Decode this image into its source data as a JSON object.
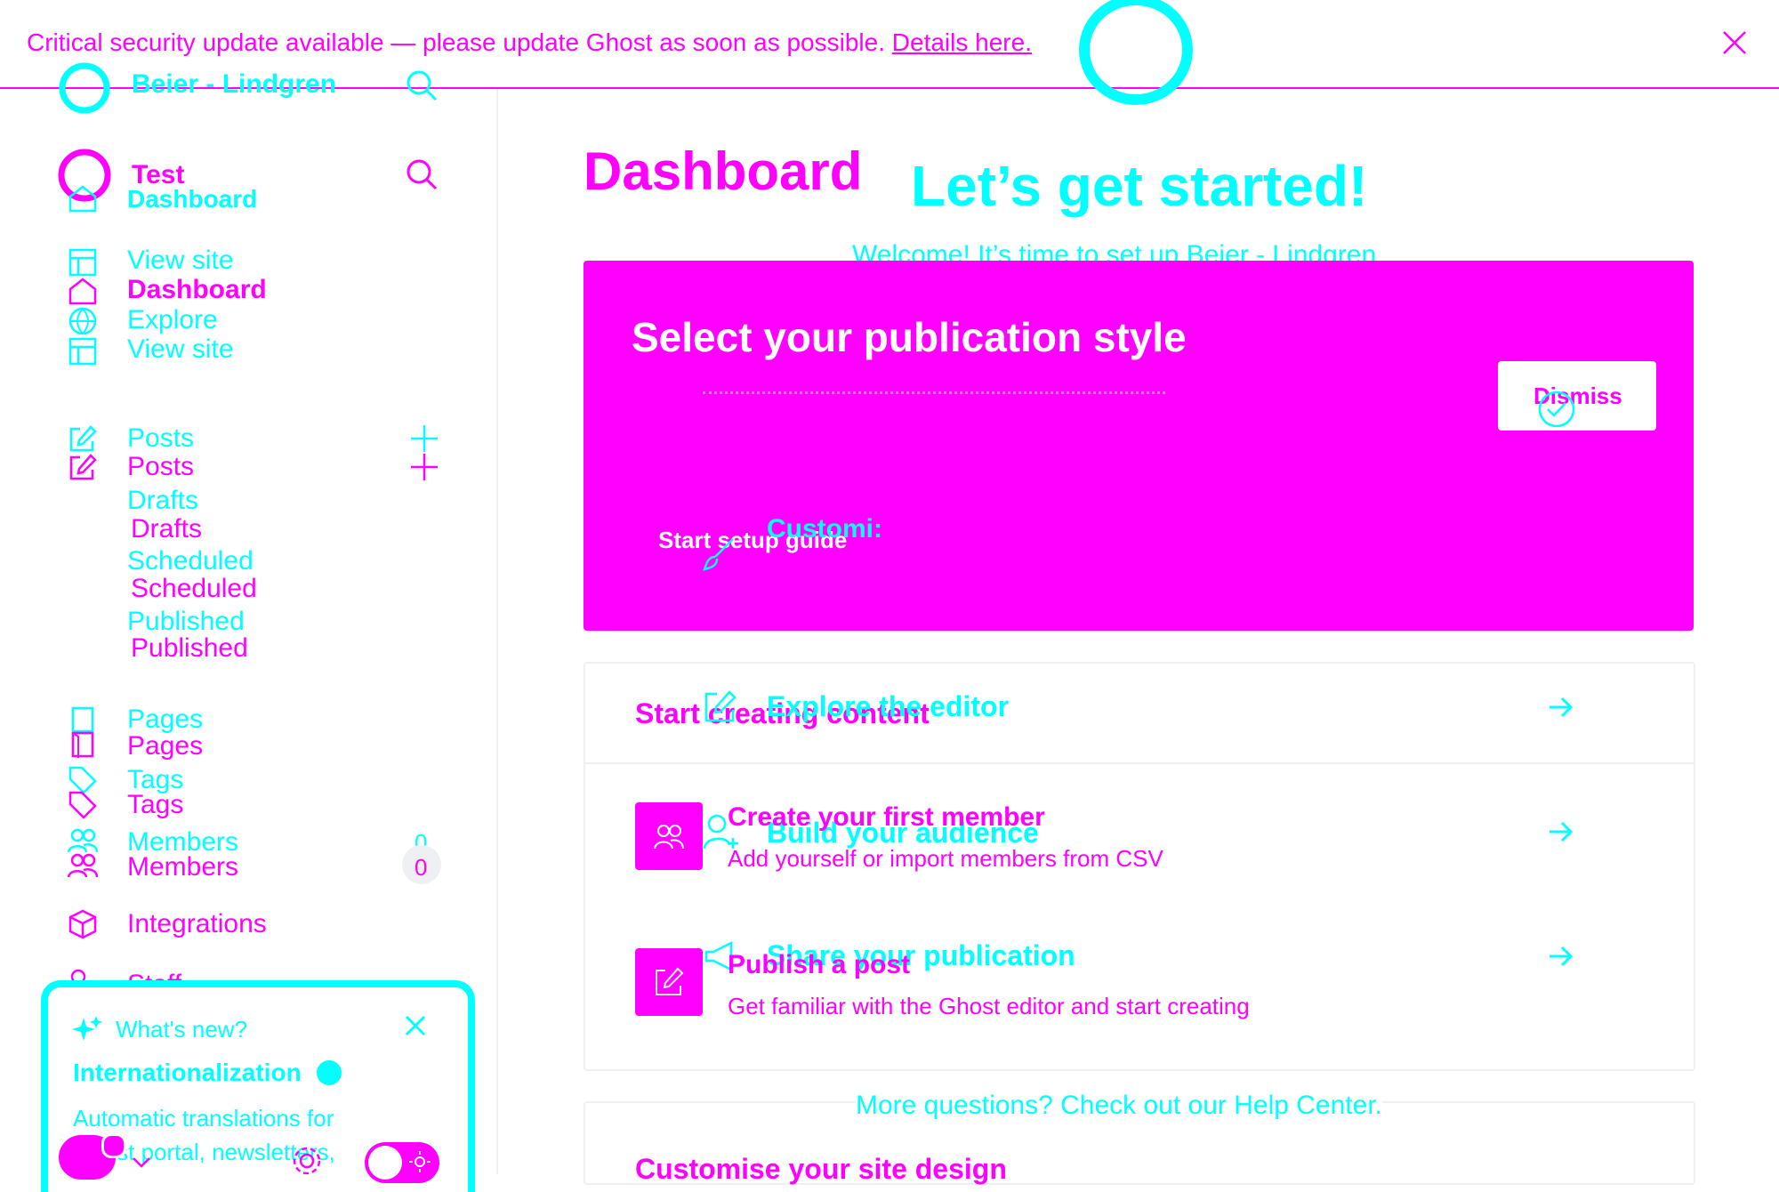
{
  "banner": {
    "text": "Critical security update available — please update Ghost as soon as possible.",
    "link": "Details here."
  },
  "sidebar": {
    "site_name_ghost": "Beier - Lindgren",
    "site_name": "Test",
    "ghost_dashboard": "Dashboard",
    "nav_ghost": [
      "View site",
      "Explore",
      "View site"
    ],
    "nav_dashboard": "Dashboard",
    "posts_ghost": "Posts",
    "posts": "Posts",
    "drafts_ghost": "Drafts",
    "drafts": "Drafts",
    "scheduled_ghost": "Scheduled",
    "scheduled": "Scheduled",
    "published_ghost": "Published",
    "published": "Published",
    "pages_ghost": "Pages",
    "pages": "Pages",
    "tags_ghost": "Tags",
    "tags": "Tags",
    "members_ghost": "Members",
    "members": "Members",
    "members_count_ghost": "0",
    "members_count": "0",
    "integrations": "Integrations",
    "staff": "Staff",
    "whats_new": {
      "label": "What's new?",
      "title": "Internationalization",
      "body": "Automatic translations for Ghost portal, newsletters,"
    }
  },
  "main": {
    "title": "Dashboard",
    "ghost_heading": "Let’s get started!",
    "ghost_welcome": "Welcome! It’s time to set up Beier - Lindgren",
    "hero": {
      "title": "Select your publication style",
      "dismiss": "Dismiss",
      "start_guide": "Start setup guide",
      "ghost_customize": "Customi:"
    },
    "start_section_title": "Start creating content",
    "ghost_rows": [
      "Explore the editor",
      "Build your audience",
      "Share your publication"
    ],
    "rows": [
      {
        "title": "Create your first member",
        "subtitle": "Add yourself or import members from CSV"
      },
      {
        "title": "Publish a post",
        "subtitle": "Get familiar with the Ghost editor and start creating"
      }
    ],
    "help": "More questions? Check out our Help Center.",
    "customise_title": "Customise your site design"
  },
  "colors": {
    "primary": "#ff00ff",
    "ghost": "#00ffff"
  }
}
